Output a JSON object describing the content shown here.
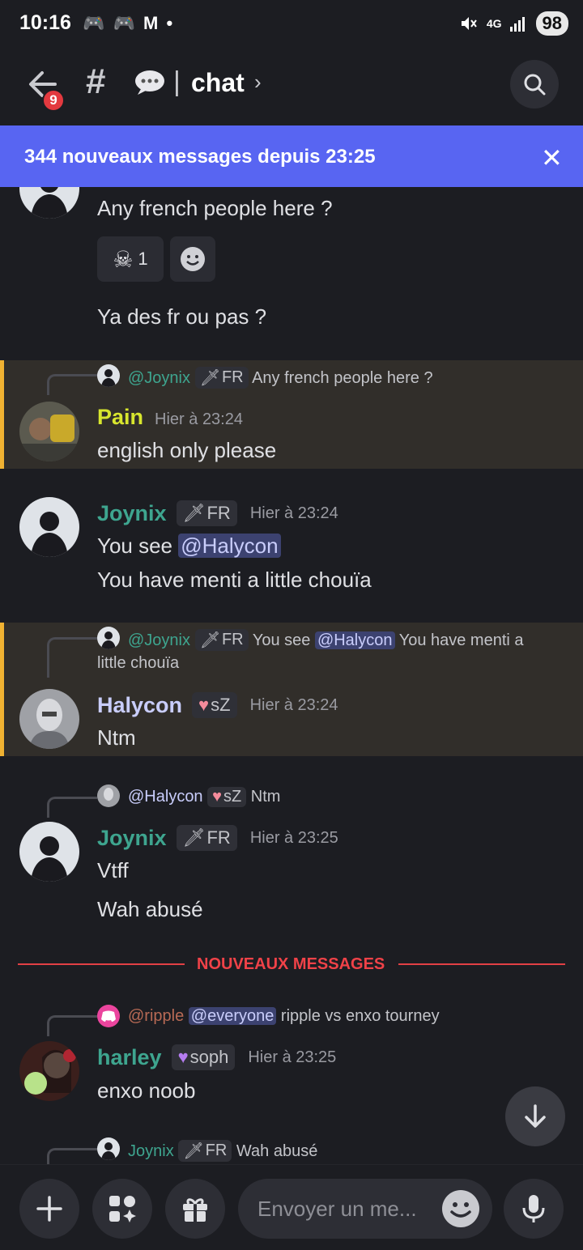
{
  "status_bar": {
    "time": "10:16",
    "icons": "🎮 🎮 M •",
    "network": "4G",
    "battery": "98"
  },
  "header": {
    "back_badge": "9",
    "hash": "#",
    "pipe": "|",
    "channel": "chat",
    "chevron": "›"
  },
  "banner": {
    "text": "344 nouveaux messages depuis 23:25",
    "close": "✕"
  },
  "messages": {
    "m1": {
      "text1": "Any french people here ?",
      "reaction_count": "1",
      "text2": "Ya des fr ou pas ?"
    },
    "m2": {
      "reply_user": "@Joynix",
      "reply_tag": "FR",
      "reply_text": "Any french people here ?",
      "username": "Pain",
      "time": "Hier à 23:24",
      "text": "english only please"
    },
    "m3": {
      "username": "Joynix",
      "tag": "FR",
      "time": "Hier à 23:24",
      "text_pre": "You see ",
      "mention": "@Halycon",
      "text2": "You have menti a little chouïa"
    },
    "m4": {
      "reply_user": "@Joynix",
      "reply_tag": "FR",
      "reply_pre": "You see ",
      "reply_mention": "@Halycon",
      "reply_post": " You have menti a",
      "reply_wrap": "little chouïa",
      "username": "Halycon",
      "tag": "sZ",
      "time": "Hier à 23:24",
      "text": "Ntm"
    },
    "m5": {
      "reply_user": "@Halycon",
      "reply_tag": "sZ",
      "reply_text": "Ntm",
      "username": "Joynix",
      "tag": "FR",
      "time": "Hier à 23:25",
      "text1": "Vtff",
      "text2": "Wah abusé"
    },
    "divider": "NOUVEAUX MESSAGES",
    "m6": {
      "reply_user": "@ripple",
      "reply_mention": "@everyone",
      "reply_text": " ripple vs enxo tourney",
      "username": "harley",
      "tag": "soph",
      "time": "Hier à 23:25",
      "text": "enxo noob"
    },
    "m7": {
      "reply_user": "Joynix",
      "reply_tag": "FR",
      "reply_text": "Wah abusé"
    }
  },
  "composer": {
    "placeholder": "Envoyer un me..."
  },
  "colors": {
    "accent": "#5865f2",
    "pain": "#d8e62e",
    "joynix": "#3ea58f",
    "halycon": "#c9cdfb",
    "harley": "#3ea58f",
    "ripple": "#b86a55",
    "new_messages": "#f04248"
  }
}
